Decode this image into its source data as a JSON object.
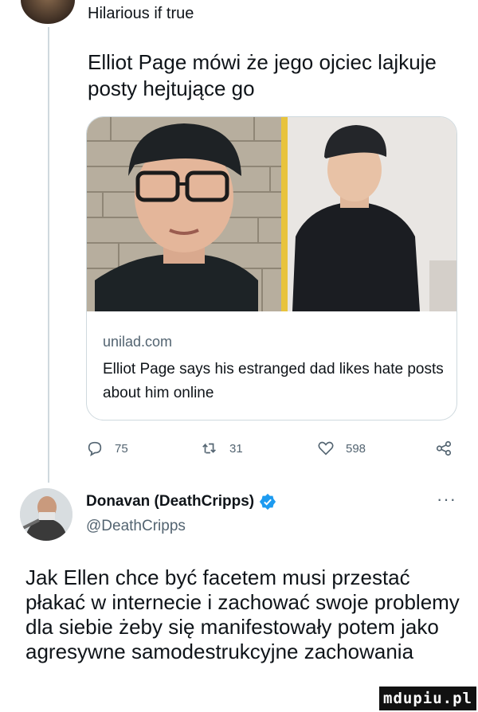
{
  "quoted_tweet": {
    "display_name": "Hilarious if true",
    "text": "Elliot Page mówi że jego ojciec lajkuje posty hejtujące go",
    "link_card": {
      "domain": "unilad.com",
      "title": "Elliot Page says his estranged dad likes hate posts about him online"
    },
    "actions": {
      "replies": "75",
      "retweets": "31",
      "likes": "598"
    }
  },
  "reply_tweet": {
    "display_name": "Donavan (DeathCripps)",
    "handle": "@DeathCripps",
    "more": "···",
    "text": "Jak Ellen chce być facetem musi przestać płakać w internecie i zachować swoje problemy dla siebie żeby się manifestowały potem jako agresywne samodestrukcyjne zachowania",
    "verified_color": "#1d9bf0"
  },
  "watermark": "mdupiu.pl",
  "icons": {
    "reply": "speech-bubble-icon",
    "retweet": "retweet-arrows-icon",
    "like": "heart-icon",
    "share": "share-nodes-icon",
    "verified": "verified-badge-icon"
  },
  "colors": {
    "text": "#0f1419",
    "secondary": "#536471",
    "border": "#cfd9de",
    "accent": "#1d9bf0"
  }
}
